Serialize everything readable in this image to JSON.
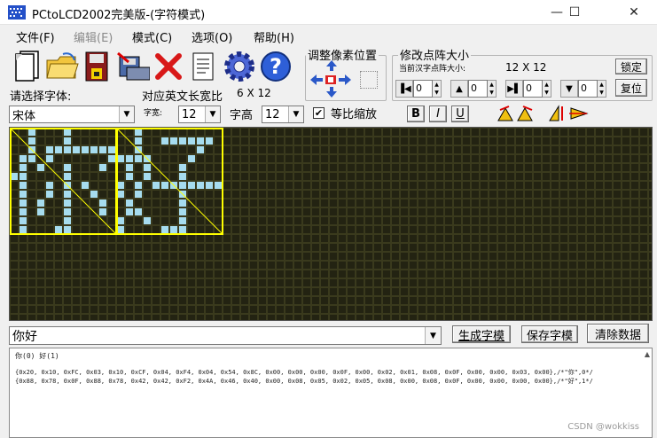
{
  "window": {
    "title": "PCtoLCD2002完美版-(字符模式)",
    "minimize": "—",
    "maximize": "☐",
    "close": "✕"
  },
  "menu": [
    "文件(F)",
    "编辑(E)",
    "模式(C)",
    "选项(O)",
    "帮助(H)"
  ],
  "toolbar": {
    "adjust_group_title": "调整像素位置",
    "size_group_title": "修改点阵大小",
    "current_size_label": "当前汉字点阵大小:",
    "current_size_value": "12  X  12",
    "lock_button": "锁定",
    "reset_button": "复位",
    "spin_values": [
      "0",
      "0",
      "0",
      "0"
    ]
  },
  "font": {
    "choose_label": "请选择字体:",
    "ascii_width_label": "对应英文长宽比",
    "ascii_width_value": "6 X 12",
    "font_name": "宋体",
    "width_label": "字宽:",
    "width_value": "12",
    "height_label": "字高",
    "height_value": "12",
    "scale_label": "等比缩放",
    "scale_checked": "✔",
    "bold": "B",
    "italic": "I",
    "underline": "U"
  },
  "lcd": {
    "background": "#3a3a1d",
    "off_color": "#232312",
    "on_color": "#a6dcef",
    "frame_color": "#ffff00",
    "glyphs": [
      {
        "char": "你",
        "rows": [
          "001000100000",
          "001000100000",
          "001011111111",
          "011010000001",
          "010100100010",
          "110000100000",
          "010010101000",
          "010010100100",
          "010100100010",
          "010100100010",
          "010000100000",
          "010001100000"
        ]
      },
      {
        "char": "好",
        "rows": [
          "001000000000",
          "001001111110",
          "001000000100",
          "111100001000",
          "010100010000",
          "010100010000",
          "101011111111",
          "101000010000",
          "010000010000",
          "011000010000",
          "100100010000",
          "100001110000"
        ]
      }
    ]
  },
  "input": {
    "text": "你好",
    "generate_button": "生成字模",
    "save_button": "保存字模",
    "clear_button": "清除数据"
  },
  "output": {
    "header": "你(0) 好(1)",
    "lines": [
      "{0x20, 0x10, 0xFC, 0x03, 0x10, 0xCF, 0x04, 0xF4, 0x04, 0x54, 0x8C, 0x00, 0x00, 0x00, 0x0F, 0x00, 0x02, 0x01, 0x08, 0x0F, 0x00, 0x00, 0x03, 0x00},/*\"你\",0*/",
      "{0x88, 0x78, 0x0F, 0x88, 0x78, 0x42, 0x42, 0xF2, 0x4A, 0x46, 0x40, 0x00, 0x08, 0x05, 0x02, 0x05, 0x08, 0x00, 0x08, 0x0F, 0x00, 0x00, 0x00, 0x00},/*\"好\",1*/"
    ],
    "watermark": "CSDN @wokkiss"
  }
}
